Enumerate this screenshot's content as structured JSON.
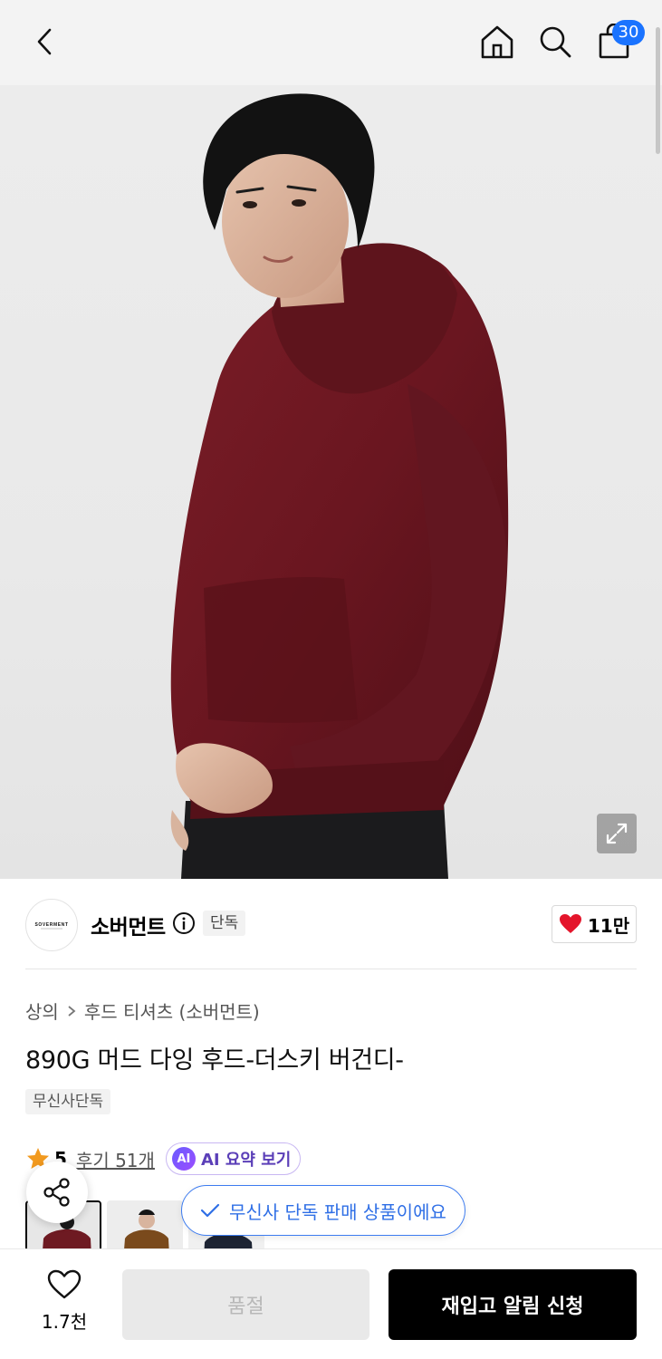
{
  "header": {
    "cart_count": "30"
  },
  "brand": {
    "logo_text": "SOVERMENT",
    "name": "소버먼트",
    "exclusive_tag": "단독",
    "likes": "11만"
  },
  "product": {
    "breadcrumb_category": "상의",
    "breadcrumb_sub": "후드 티셔츠 (소버먼트)",
    "title": "890G 머드 다잉 후드-더스키 버건디-",
    "tag": "무신사단독",
    "rating": "5",
    "reviews": "후기 51개",
    "ai_badge": "AI",
    "ai_summary": "AI 요약 보기"
  },
  "toast": {
    "message": "무신사 단독 판매 상품이에요"
  },
  "bottom": {
    "wish_count": "1.7천",
    "soldout_label": "품절",
    "restock_label": "재입고 알림 신청"
  },
  "colors": {
    "accent_blue": "#1a73ff",
    "hoodie_burgundy": "#6e1a22",
    "heart_red": "#e4152b",
    "star_orange": "#f29a1f"
  }
}
